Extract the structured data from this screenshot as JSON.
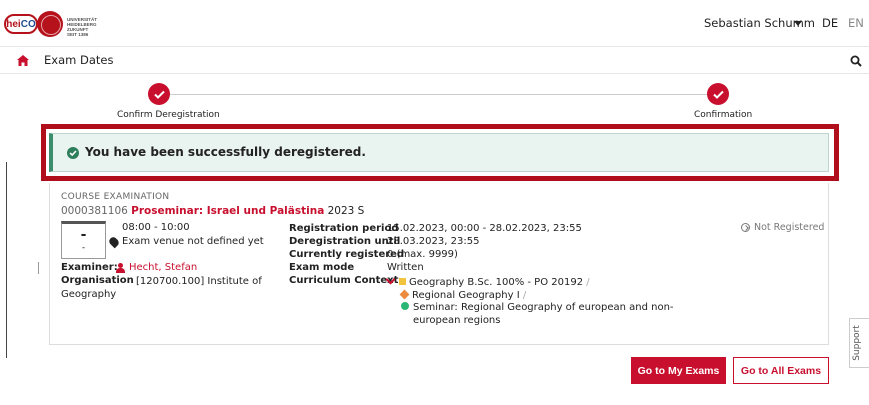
{
  "header": {
    "logo_text_he": "hei",
    "logo_text_co": "CO",
    "university_text": "UNIVERSITÄT HEIDELBERG ZUKUNFT SEIT 1386",
    "user_name": "Sebastian Schumm",
    "lang_de": "DE",
    "lang_en": "EN"
  },
  "nav": {
    "title": "Exam Dates"
  },
  "steps": [
    {
      "label": "Confirm Deregistration"
    },
    {
      "label": "Confirmation"
    }
  ],
  "alert": {
    "message": "You have been successfully deregistered."
  },
  "course": {
    "type": "COURSE EXAMINATION",
    "number": "0000381106",
    "title": "Proseminar: Israel und Palästina",
    "term": "2023 S",
    "date_day": "-",
    "date_sub": "-",
    "time": "08:00 - 10:00",
    "venue": "Exam venue not defined yet",
    "examiner_label": "Examiner:",
    "examiner": "Hecht, Stefan",
    "organisation_label": "Organisation",
    "organisation": "[120700.100] Institute of Geography",
    "status": "Not Registered",
    "details": {
      "registration_period_label": "Registration period",
      "registration_period": "15.02.2023, 00:00 - 28.02.2023, 23:55",
      "deregistration_until_label": "Deregistration until",
      "deregistration_until": "28.03.2023, 23:55",
      "currently_registered_label": "Currently registered",
      "currently_registered": "0 (max. 9999)",
      "exam_mode_label": "Exam mode",
      "exam_mode": "Written",
      "curriculum_context_label": "Curriculum Context",
      "curriculum": [
        "Geography B.Sc. 100% - PO 20192",
        "Regional Geography I",
        "Seminar: Regional Geography of european and non-",
        "european regions"
      ]
    }
  },
  "buttons": {
    "my_exams": "Go to My Exams",
    "all_exams": "Go to All Exams"
  },
  "support": {
    "label": "Support"
  },
  "colors": {
    "accent": "#c8102e",
    "highlight": "#b00e1a",
    "success": "#2e7d5b"
  }
}
